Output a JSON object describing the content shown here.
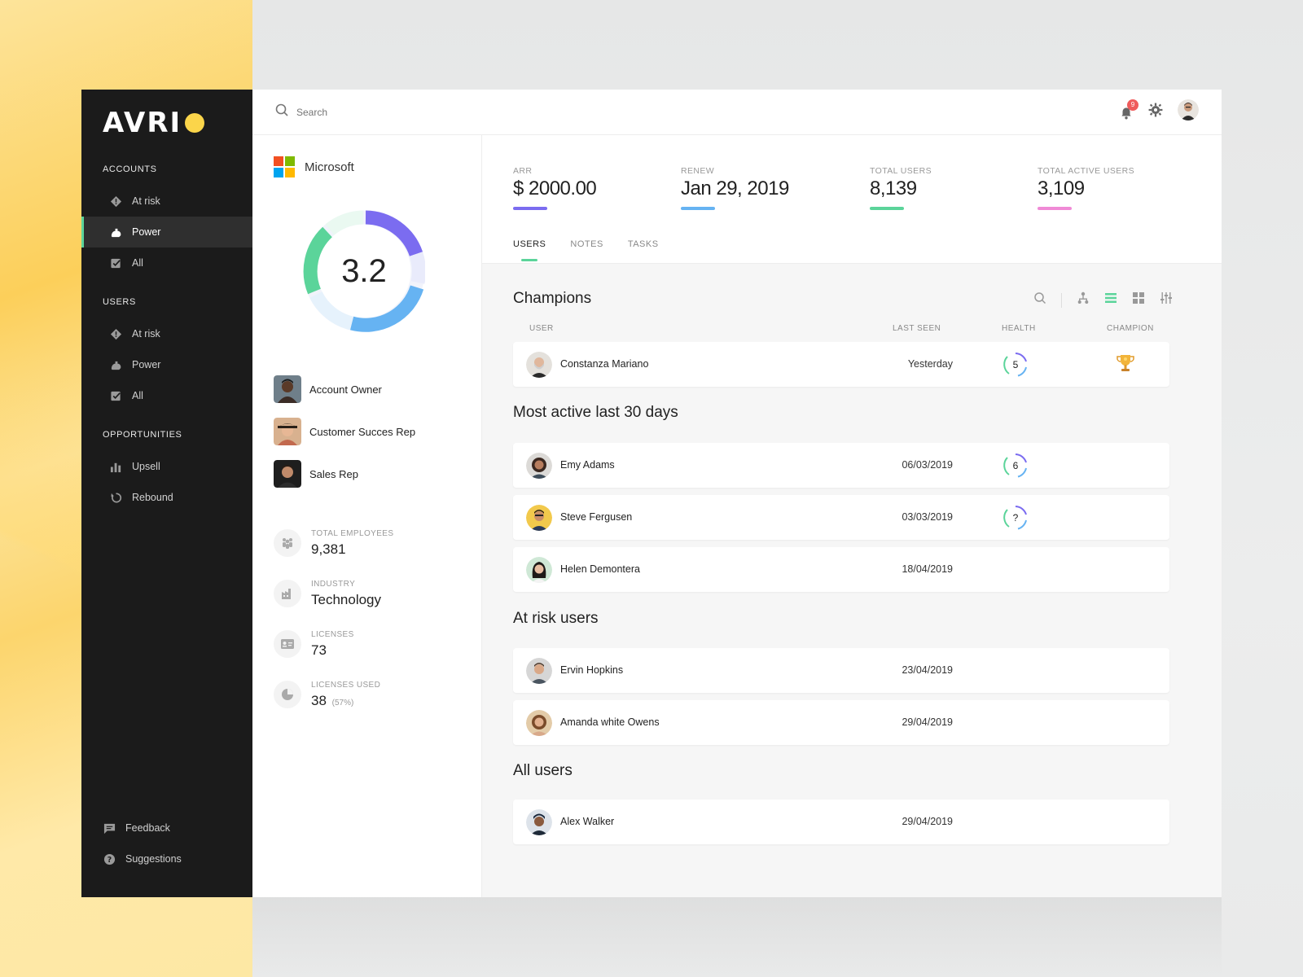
{
  "sidebar": {
    "logo": "AVRI",
    "sections": [
      {
        "title": "ACCOUNTS",
        "items": [
          {
            "label": "At risk",
            "icon": "alert-diamond-icon"
          },
          {
            "label": "Power",
            "icon": "flexed-arm-icon",
            "active": true
          },
          {
            "label": "All",
            "icon": "checkbox-icon"
          }
        ]
      },
      {
        "title": "USERS",
        "items": [
          {
            "label": "At risk",
            "icon": "alert-diamond-icon"
          },
          {
            "label": "Power",
            "icon": "flexed-arm-icon"
          },
          {
            "label": "All",
            "icon": "checkbox-icon"
          }
        ]
      },
      {
        "title": "OPPORTUNITIES",
        "items": [
          {
            "label": "Upsell",
            "icon": "bar-chart-icon"
          },
          {
            "label": "Rebound",
            "icon": "refresh-icon"
          }
        ]
      }
    ],
    "bottom": [
      {
        "label": "Feedback",
        "icon": "feedback-icon"
      },
      {
        "label": "Suggestions",
        "icon": "question-icon"
      }
    ]
  },
  "topbar": {
    "search_placeholder": "Search",
    "notification_count": "9"
  },
  "account": {
    "company": "Microsoft",
    "score": "3.2",
    "team": [
      {
        "role": "Account Owner"
      },
      {
        "role": "Customer Succes Rep"
      },
      {
        "role": "Sales Rep"
      }
    ],
    "stats": [
      {
        "label": "TOTAL EMPLOYEES",
        "value": "9,381",
        "sub": "",
        "icon": "people-icon"
      },
      {
        "label": "INDUSTRY",
        "value": "Technology",
        "sub": "",
        "icon": "factory-icon"
      },
      {
        "label": "LICENSES",
        "value": "73",
        "sub": "",
        "icon": "id-card-icon"
      },
      {
        "label": "LICENSES USED",
        "value": "38",
        "sub": "(57%)",
        "icon": "pie-icon"
      }
    ]
  },
  "kpis": [
    {
      "label": "ARR",
      "value": "$ 2000.00",
      "color": "#7b6cf0"
    },
    {
      "label": "RENEW",
      "value": "Jan 29, 2019",
      "color": "#66b3f2"
    },
    {
      "label": "TOTAL USERS",
      "value": "8,139",
      "color": "#5bd49a"
    },
    {
      "label": "TOTAL ACTIVE USERS",
      "value": "3,109",
      "color": "#f08ad6"
    }
  ],
  "tabs": [
    "USERS",
    "NOTES",
    "TASKS"
  ],
  "columns": {
    "user": "USER",
    "last_seen": "LAST SEEN",
    "health": "HEALTH",
    "champion": "CHAMPION"
  },
  "sections": {
    "champions": "Champions",
    "most_active": "Most active last 30 days",
    "at_risk": "At risk users",
    "all_users": "All users"
  },
  "champions": [
    {
      "name": "Constanza Mariano",
      "last_seen": "Yesterday",
      "health": "5",
      "champion": true
    }
  ],
  "most_active": [
    {
      "name": "Emy Adams",
      "last_seen": "06/03/2019",
      "health": "6"
    },
    {
      "name": "Steve Fergusen",
      "last_seen": "03/03/2019",
      "health": "?"
    },
    {
      "name": "Helen Demontera",
      "last_seen": "18/04/2019",
      "health": ""
    }
  ],
  "at_risk": [
    {
      "name": "Ervin Hopkins",
      "last_seen": "23/04/2019"
    },
    {
      "name": "Amanda white Owens",
      "last_seen": "29/04/2019"
    }
  ],
  "all_users": [
    {
      "name": "Alex Walker",
      "last_seen": "29/04/2019"
    }
  ],
  "colors": {
    "accent_green": "#5bd49a",
    "accent_purple": "#7b6cf0",
    "accent_blue": "#66b3f2",
    "accent_pink": "#f08ad6",
    "sidebar_bg": "#1b1b1b"
  }
}
